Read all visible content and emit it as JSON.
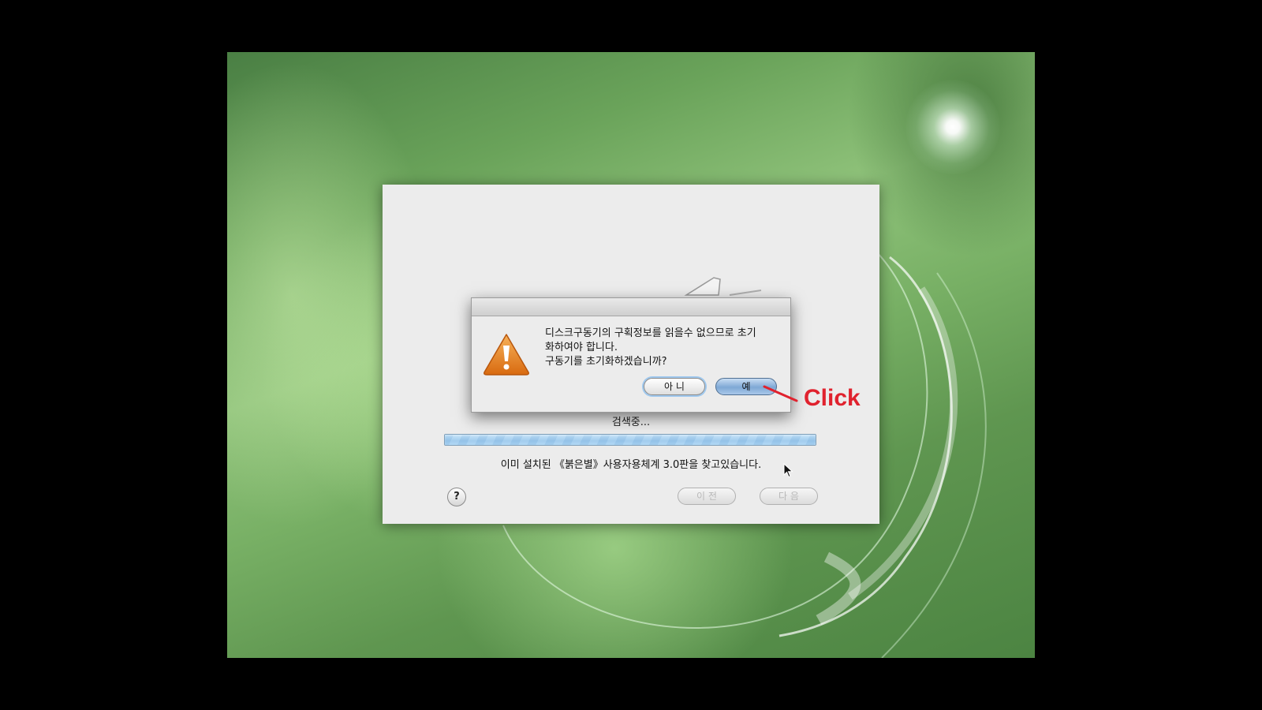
{
  "installer": {
    "status_searching": "검색중...",
    "found_text": "이미 설치된 《붉은별》사용자용체계 3.0판을 찾고있습니다.",
    "progress": 1.0,
    "help_label": "?",
    "prev_label": "이 전",
    "next_label": "다 음"
  },
  "alert": {
    "message_line1": "디스크구동기의 구획정보를 읽을수 없으므로 초기",
    "message_line2": "화하여야 합니다.",
    "message_line3": "구동기를 초기화하겠습니까?",
    "no_label": "아 니",
    "yes_label": "예",
    "icon": "warning-icon"
  },
  "annotation": {
    "label": "Click",
    "color": "#e0222e"
  }
}
